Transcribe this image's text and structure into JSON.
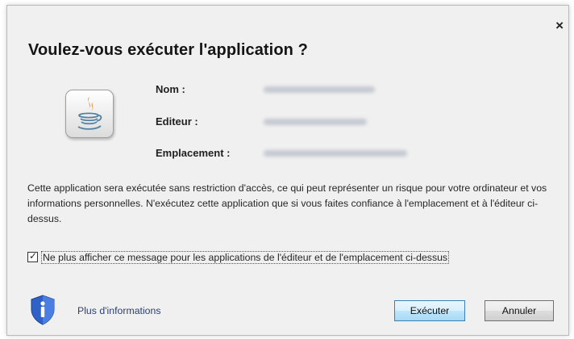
{
  "dialog": {
    "close_glyph": "×",
    "title": "Voulez-vous exécuter l'application ?",
    "app_icon": "java-icon",
    "fields": [
      {
        "label": "Nom :"
      },
      {
        "label": "Editeur :"
      },
      {
        "label": "Emplacement :"
      }
    ],
    "description": "Cette application sera exécutée sans restriction d'accès, ce qui peut représenter un risque pour votre ordinateur et vos informations personnelles. N'exécutez cette application que si vous faites confiance à l'emplacement et à l'éditeur ci-dessus.",
    "checkbox": {
      "checked": true,
      "check_glyph": "✓",
      "label": "Ne plus afficher ce message pour les applications de l'éditeur et de l'emplacement ci-dessus"
    },
    "info_icon": "shield-info-icon",
    "more_info_link": "Plus d'informations",
    "buttons": {
      "run": "Exécuter",
      "cancel": "Annuler"
    }
  }
}
